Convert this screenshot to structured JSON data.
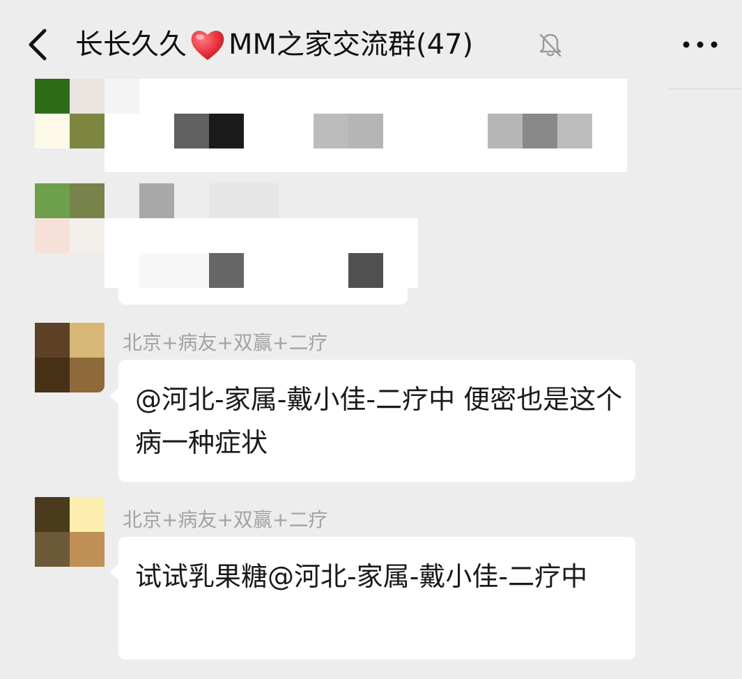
{
  "header": {
    "back_label": "back",
    "title_before": "长长久久",
    "title_after": "MM之家交流群(47)",
    "more_label": "more"
  },
  "messages": [
    {
      "sender": "北京+病友+双赢+二疗",
      "text": "@河北-家属-戴小佳-二疗中  便密也是这个病一种症状"
    },
    {
      "sender": "北京+病友+双赢+二疗",
      "text": "试试乳果糖@河北-家属-戴小佳-二疗中"
    }
  ],
  "colors": {
    "background": "#ededed",
    "bubble": "#ffffff",
    "sender_name": "#a3a3a3",
    "heart": "#e8303a"
  }
}
